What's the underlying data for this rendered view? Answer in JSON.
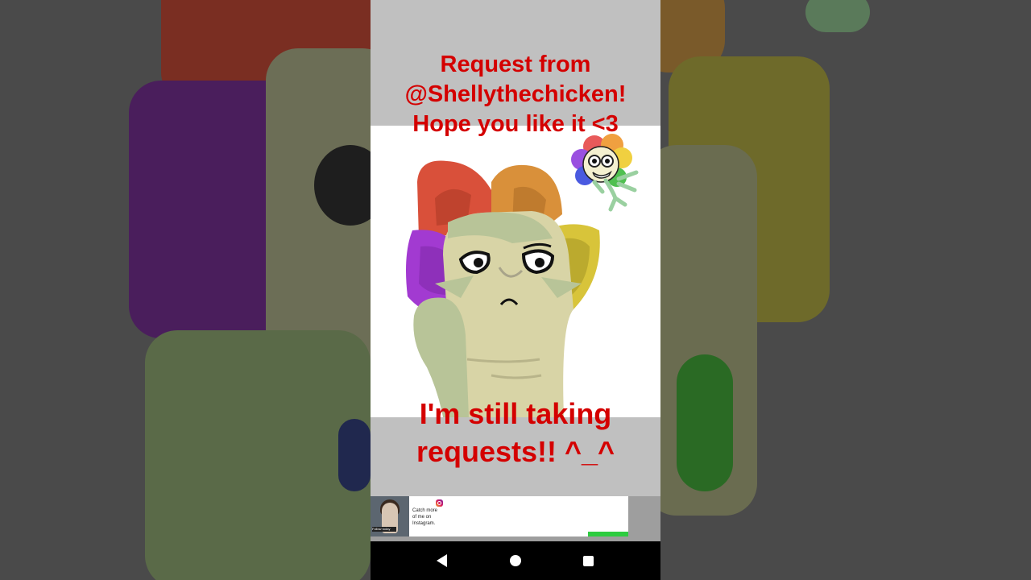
{
  "caption_top": {
    "line1": "Request from",
    "line2": "@Shellythechicken!",
    "line3": "Hope you like it <3"
  },
  "caption_bottom": {
    "line1": "I'm still taking",
    "line2": "requests!! ^_^"
  },
  "ad": {
    "line1": "Catch more",
    "line2": "of me on",
    "line3": "Instagram.",
    "thumb_tag": "Follow today",
    "icon": "instagram-icon"
  },
  "navbar": {
    "back_icon": "back-triangle-icon",
    "home_icon": "home-circle-icon",
    "recents_icon": "recents-square-icon"
  },
  "colors": {
    "caption_red": "#d40000",
    "petal_red": "#d9503a",
    "petal_orange": "#d9903a",
    "petal_yellow": "#d8c43a",
    "petal_purple": "#a23ad1",
    "petal_blue": "#3a4ad1",
    "petal_green": "#4ad13a",
    "skin": "#d8d4a6",
    "skin_shadow": "#b8c498"
  }
}
